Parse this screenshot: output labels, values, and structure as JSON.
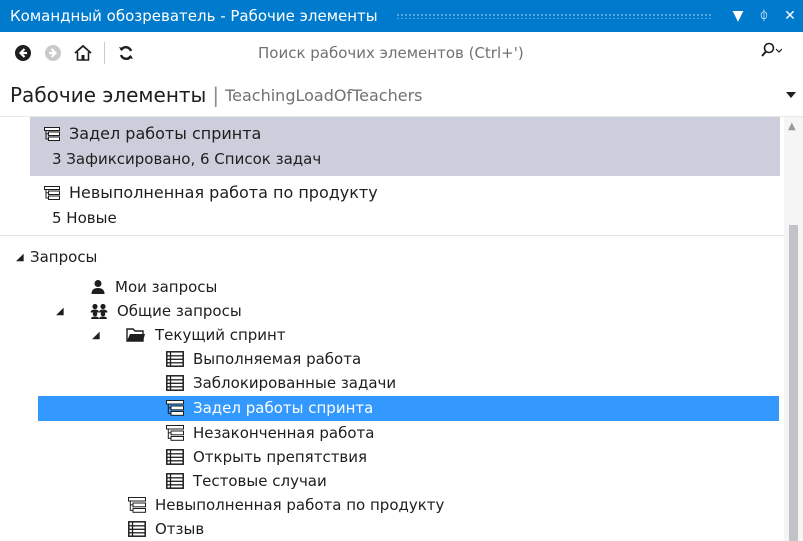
{
  "window": {
    "title": "Командный обозреватель - Рабочие элементы",
    "buttons": {
      "menu": "▼",
      "pin": "ᛰ",
      "close": "✕"
    }
  },
  "toolbar": {
    "icons": [
      "back-arrow-icon",
      "forward-arrow-icon",
      "home-icon",
      "refresh-icon"
    ],
    "search_placeholder": "Поиск рабочих элементов (Ctrl+')"
  },
  "header": {
    "title": "Рабочие элементы",
    "separator": "|",
    "project": "TeachingLoadOfTeachers"
  },
  "favorites": [
    {
      "title": "Задел работы спринта",
      "subtitle": "3 Зафиксировано, 6 Список задач",
      "selected": true
    },
    {
      "title": "Невыполненная работа по продукту",
      "subtitle": "5 Новые",
      "selected": false
    }
  ],
  "tree": {
    "root": "Запросы",
    "my_queries": "Мои запросы",
    "shared_queries": "Общие запросы",
    "current_sprint": "Текущий спринт",
    "sprint_items": [
      {
        "label": "Выполняемая работа",
        "icon": "flat-list-icon"
      },
      {
        "label": "Заблокированные задачи",
        "icon": "flat-list-icon"
      },
      {
        "label": "Задел работы спринта",
        "icon": "tree-query-icon",
        "selected": true
      },
      {
        "label": "Незаконченная работа",
        "icon": "tree-query-icon"
      },
      {
        "label": "Открыть препятствия",
        "icon": "flat-list-icon"
      },
      {
        "label": "Тестовые случаи",
        "icon": "flat-list-icon"
      }
    ],
    "shared_items": [
      {
        "label": "Невыполненная работа по продукту",
        "icon": "tree-query-icon"
      },
      {
        "label": "Отзыв",
        "icon": "flat-list-icon"
      }
    ]
  },
  "colors": {
    "accent": "#007acc",
    "selection": "#3399ff",
    "tile_selected": "#ccceDB"
  }
}
